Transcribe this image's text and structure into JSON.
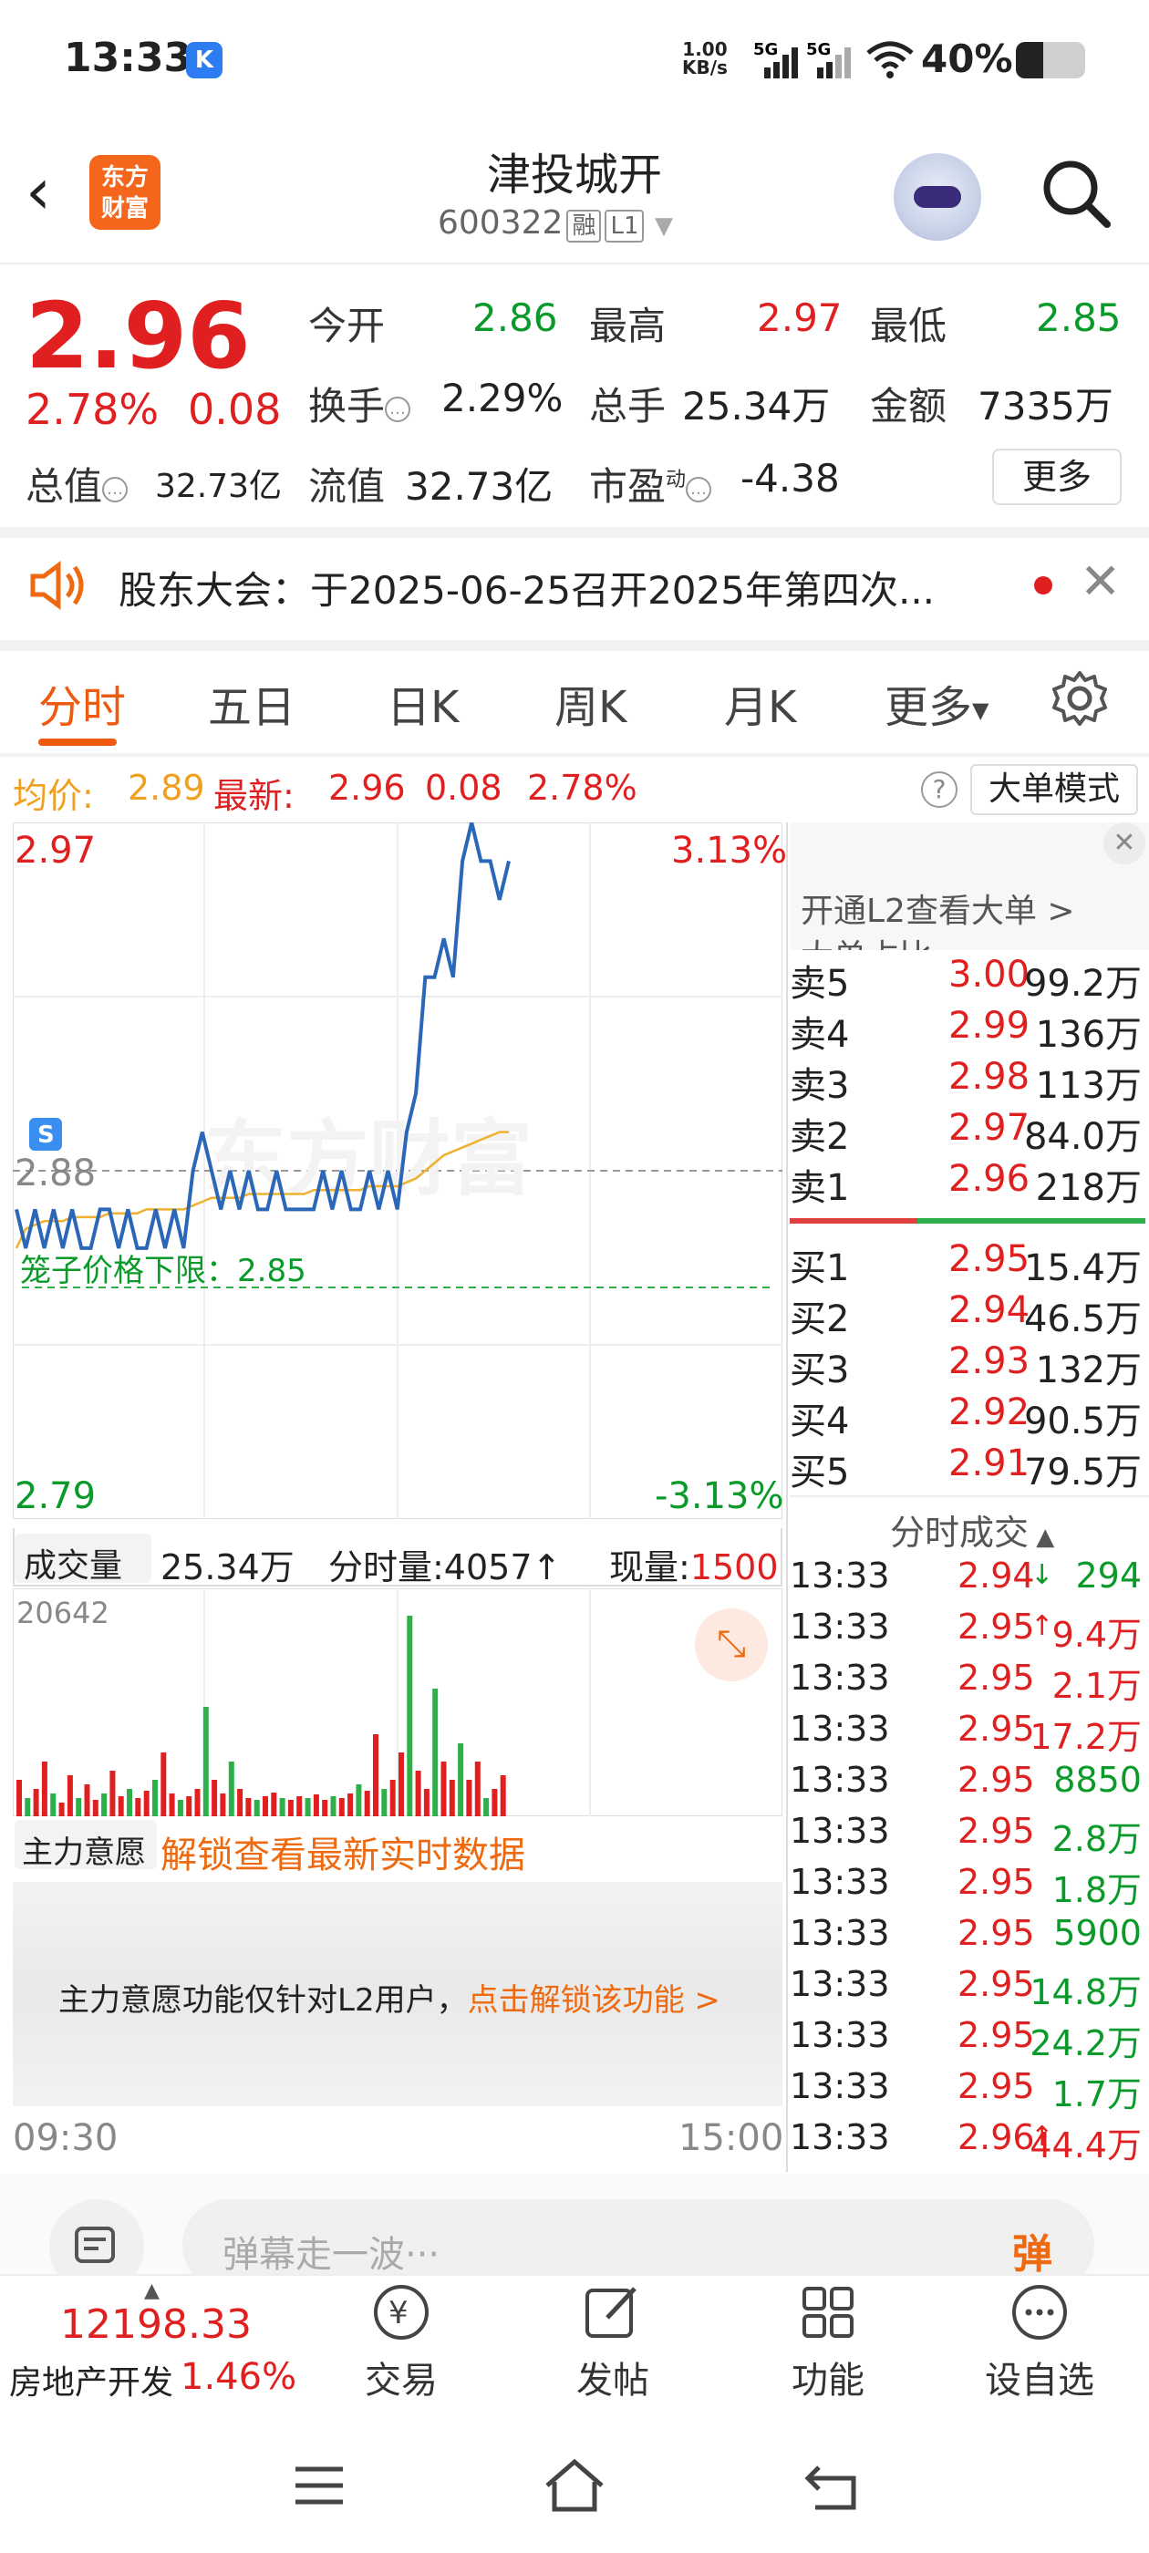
{
  "status": {
    "time": "13:33",
    "speed_top": "1.00",
    "speed_bottom": "KB/s",
    "net1": "5G",
    "net2": "5G",
    "battery": "40%"
  },
  "header": {
    "name": "津投城开",
    "code": "600322",
    "tag1": "融",
    "tag2": "L1",
    "logo_top": "东方",
    "logo_bottom": "财富"
  },
  "quote": {
    "price": "2.96",
    "chg_pct": "2.78%",
    "chg": "0.08",
    "open_lbl": "今开",
    "open": "2.86",
    "high_lbl": "最高",
    "high": "2.97",
    "low_lbl": "最低",
    "low": "2.85",
    "turnover_lbl": "换手",
    "turnover": "2.29%",
    "vol_lbl": "总手",
    "vol": "25.34万",
    "amt_lbl": "金额",
    "amt": "7335万",
    "mcap_lbl": "总值",
    "mcap": "32.73亿",
    "float_lbl": "流值",
    "float": "32.73亿",
    "pe_lbl": "市盈",
    "pe_sup": "动",
    "pe": "-4.38",
    "more": "更多"
  },
  "notice": {
    "text": "股东大会：于2025-06-25召开2025年第四次..."
  },
  "tabs": [
    "分时",
    "五日",
    "日K",
    "周K",
    "月K",
    "更多"
  ],
  "avgrow": {
    "avg_lbl": "均价:",
    "avg": "2.89",
    "new_lbl": "最新:",
    "new": "2.96",
    "chg": "0.08",
    "pct": "2.78%",
    "big_order": "大单模式"
  },
  "chart": {
    "top_price": "2.97",
    "top_pct": "3.13%",
    "bottom_price": "2.79",
    "bottom_pct": "-3.13%",
    "ref_price": "2.88",
    "limit_text": "笼子价格下限：2.85",
    "watermark": "东方财富",
    "vol_lbl": "成交量",
    "vol_total": "25.34万",
    "tick_vol": "分时量:4057",
    "cur_lbl": "现量:",
    "cur_vol": "1500",
    "vol_max": "20642",
    "main_lbl": "主力意愿",
    "unlock": "解锁查看最新实时数据",
    "l2_text": "主力意愿功能仅针对L2用户，",
    "l2_link": "点击解锁该功能 >",
    "t_start": "09:30",
    "t_end": "15:00",
    "chart_data": {
      "type": "line",
      "title": "",
      "x_range": [
        "09:30",
        "15:00"
      ],
      "ylim": [
        2.79,
        2.97
      ],
      "series": [
        {
          "values": [
            2.87,
            2.86,
            2.87,
            2.86,
            2.87,
            2.86,
            2.87,
            2.86,
            2.86,
            2.87,
            2.87,
            2.86,
            2.87,
            2.86,
            2.86,
            2.87,
            2.86,
            2.87,
            2.86,
            2.88,
            2.89,
            2.88,
            2.87,
            2.88,
            2.87,
            2.88,
            2.87,
            2.87,
            2.88,
            2.87,
            2.87,
            2.87,
            2.87,
            2.88,
            2.87,
            2.88,
            2.87,
            2.87,
            2.88,
            2.87,
            2.88,
            2.87,
            2.89,
            2.9,
            2.93,
            2.93,
            2.94,
            2.93,
            2.96,
            2.97,
            2.96,
            2.96,
            2.95,
            2.96
          ]
        },
        {
          "values": [
            2.86,
            2.865,
            2.866,
            2.867,
            2.867,
            2.867,
            2.868,
            2.868,
            2.868,
            2.868,
            2.869,
            2.869,
            2.869,
            2.869,
            2.87,
            2.87,
            2.87,
            2.87,
            2.87,
            2.871,
            2.872,
            2.873,
            2.873,
            2.873,
            2.873,
            2.874,
            2.874,
            2.874,
            2.874,
            2.874,
            2.874,
            2.874,
            2.875,
            2.875,
            2.875,
            2.875,
            2.875,
            2.875,
            2.876,
            2.876,
            2.876,
            2.876,
            2.877,
            2.878,
            2.88,
            2.882,
            2.884,
            2.885,
            2.886,
            2.887,
            2.888,
            2.889,
            2.89,
            2.89
          ]
        }
      ]
    }
  },
  "panel": {
    "title_hint": "开通L2查看大单 >",
    "ratio_lbl": "大单占比"
  },
  "asks": [
    {
      "lbl": "卖5",
      "p": "3.00",
      "v": "99.2万"
    },
    {
      "lbl": "卖4",
      "p": "2.99",
      "v": "136万"
    },
    {
      "lbl": "卖3",
      "p": "2.98",
      "v": "113万"
    },
    {
      "lbl": "卖2",
      "p": "2.97",
      "v": "84.0万"
    },
    {
      "lbl": "卖1",
      "p": "2.96",
      "v": "218万"
    }
  ],
  "bids": [
    {
      "lbl": "买1",
      "p": "2.95",
      "v": "15.4万"
    },
    {
      "lbl": "买2",
      "p": "2.94",
      "v": "46.5万"
    },
    {
      "lbl": "买3",
      "p": "2.93",
      "v": "132万"
    },
    {
      "lbl": "买4",
      "p": "2.92",
      "v": "90.5万"
    },
    {
      "lbl": "买5",
      "p": "2.91",
      "v": "79.5万"
    }
  ],
  "trades_title": "分时成交",
  "trades": [
    {
      "t": "13:33",
      "p": "2.94",
      "arrow": "↓",
      "v": "294",
      "vc": "green"
    },
    {
      "t": "13:33",
      "p": "2.95",
      "arrow": "↑",
      "v": "9.4万",
      "vc": "red"
    },
    {
      "t": "13:33",
      "p": "2.95",
      "arrow": "",
      "v": "2.1万",
      "vc": "red"
    },
    {
      "t": "13:33",
      "p": "2.95",
      "arrow": "",
      "v": "17.2万",
      "vc": "red"
    },
    {
      "t": "13:33",
      "p": "2.95",
      "arrow": "",
      "v": "8850",
      "vc": "green"
    },
    {
      "t": "13:33",
      "p": "2.95",
      "arrow": "",
      "v": "2.8万",
      "vc": "green"
    },
    {
      "t": "13:33",
      "p": "2.95",
      "arrow": "",
      "v": "1.8万",
      "vc": "green"
    },
    {
      "t": "13:33",
      "p": "2.95",
      "arrow": "",
      "v": "5900",
      "vc": "green"
    },
    {
      "t": "13:33",
      "p": "2.95",
      "arrow": "",
      "v": "14.8万",
      "vc": "green"
    },
    {
      "t": "13:33",
      "p": "2.95",
      "arrow": "",
      "v": "24.2万",
      "vc": "green"
    },
    {
      "t": "13:33",
      "p": "2.95",
      "arrow": "",
      "v": "1.7万",
      "vc": "green"
    },
    {
      "t": "13:33",
      "p": "2.96",
      "arrow": "↑",
      "v": "44.4万",
      "vc": "red"
    }
  ],
  "comment": {
    "placeholder": "弹幕走一波···",
    "btn": "弹"
  },
  "bottom": {
    "index_val": "12198.33",
    "index_name": "房地产开发",
    "index_pct": "1.46%",
    "trade": "交易",
    "post": "发帖",
    "func": "功能",
    "watch": "设自选"
  },
  "colors": {
    "up": "#e02020",
    "down": "#0a9a2a",
    "accent": "#ee5a10",
    "price_line": "#2b67b8",
    "avg_line": "#f0b030"
  }
}
